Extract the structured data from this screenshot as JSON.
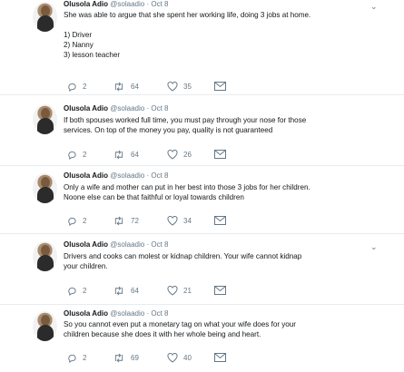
{
  "tweets": [
    {
      "name": "Olusola Adio",
      "handle": "@solaadio",
      "date": "Oct 8",
      "text_lines": [
        "She was able to argue that she spent her working life, doing 3 jobs at home.",
        "",
        "1) Driver",
        "2) Nanny",
        "3) lesson teacher"
      ],
      "replies": "2",
      "retweets": "64",
      "likes": "35"
    },
    {
      "name": "Olusola Adio",
      "handle": "@solaadio",
      "date": "Oct 8",
      "text_lines": [
        "If both spouses worked full time, you must pay through your nose for those",
        "services. On top of the money you pay, quality is not guaranteed"
      ],
      "replies": "2",
      "retweets": "64",
      "likes": "26"
    },
    {
      "name": "Olusola Adio",
      "handle": "@solaadio",
      "date": "Oct 8",
      "text_lines": [
        "Only a wife and mother can put in her best into those 3 jobs for her children.",
        "Noone else can be that faithful or loyal towards children"
      ],
      "replies": "2",
      "retweets": "72",
      "likes": "34"
    },
    {
      "name": "Olusola Adio",
      "handle": "@solaadio",
      "date": "Oct 8",
      "text_lines": [
        "Drivers and cooks can molest or kidnap children. Your wife cannot kidnap",
        "your children."
      ],
      "replies": "2",
      "retweets": "64",
      "likes": "21"
    },
    {
      "name": "Olusola Adio",
      "handle": "@solaadio",
      "date": "Oct 8",
      "text_lines": [
        "So you cannot even put a monetary tag on what your wife does for your",
        "children because she does it with her whole being and heart."
      ],
      "replies": "2",
      "retweets": "69",
      "likes": "40"
    }
  ],
  "separator": "·",
  "icons": {
    "reply": "reply-icon",
    "retweet": "retweet-icon",
    "like": "heart-icon",
    "dm": "envelope-icon",
    "menu": "chevron-down-icon"
  },
  "colors": {
    "text": "#14171a",
    "meta": "#657786",
    "divider": "#e6ecf0"
  }
}
